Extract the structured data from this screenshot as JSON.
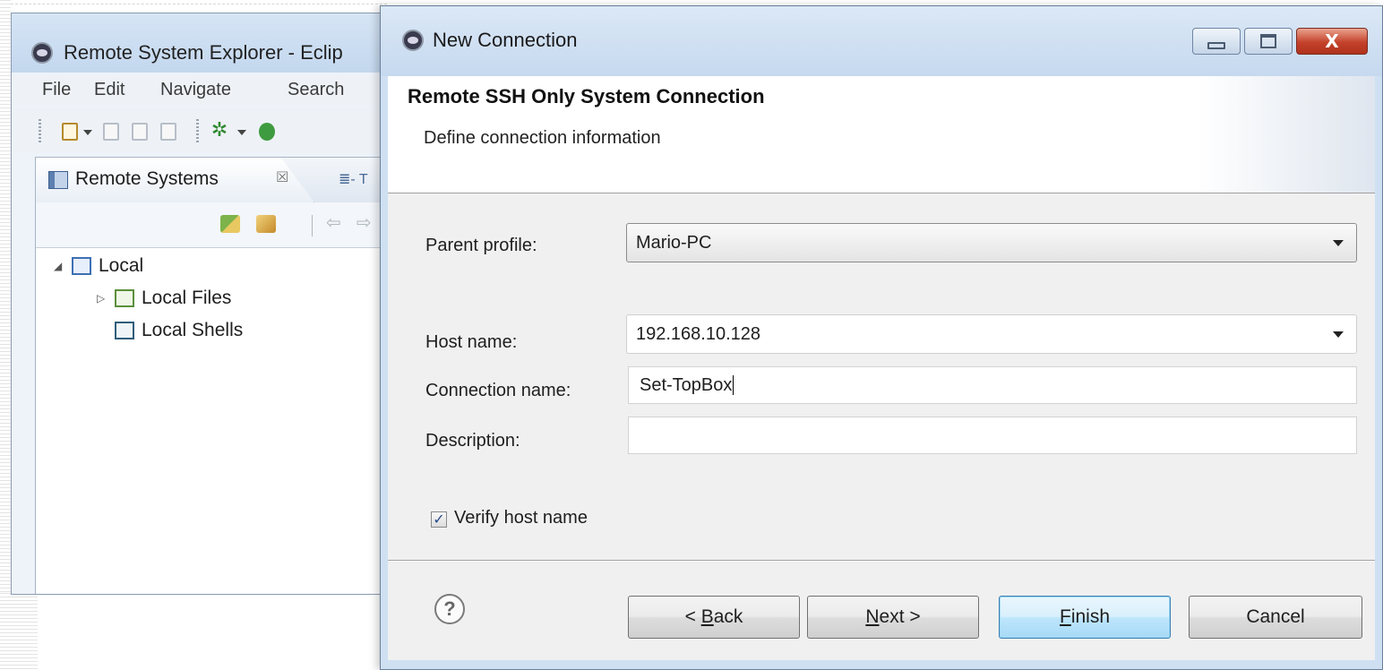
{
  "eclipse": {
    "title": "Remote System Explorer - Eclip",
    "menu": [
      "File",
      "Edit",
      "Navigate",
      "Search"
    ],
    "view": {
      "tab_label": "Remote Systems",
      "tab_close": "☒",
      "second_tab_glyph": "≣- T"
    },
    "tree": {
      "root": {
        "label": "Local",
        "expanded": true,
        "icon": "local-system-icon"
      },
      "children": [
        {
          "label": "Local Files",
          "icon": "local-files-icon",
          "expandable": true
        },
        {
          "label": "Local Shells",
          "icon": "local-shells-icon",
          "expandable": false
        }
      ]
    }
  },
  "dialog": {
    "window_title": "New Connection",
    "header_title": "Remote SSH Only System Connection",
    "header_description": "Define connection information",
    "fields": {
      "parent_profile": {
        "label": "Parent profile:",
        "value": "Mario-PC"
      },
      "host_name": {
        "label": "Host name:",
        "value": "192.168.10.128"
      },
      "connection_name": {
        "label": "Connection name:",
        "value": "Set-TopBox"
      },
      "description": {
        "label": "Description:",
        "value": ""
      }
    },
    "verify_host": {
      "label": "Verify host name",
      "checked": true
    },
    "buttons": {
      "back_prefix": "< ",
      "back_mnemonic": "B",
      "back_rest": "ack",
      "next_mnemonic": "N",
      "next_rest": "ext >",
      "finish_mnemonic": "F",
      "finish_rest": "inish",
      "cancel": "Cancel"
    },
    "help_glyph": "?",
    "close_glyph": "X"
  },
  "colors": {
    "title_bar": "#c6d9ef",
    "close_button": "#c4412a",
    "default_button": "#bee6fd"
  }
}
